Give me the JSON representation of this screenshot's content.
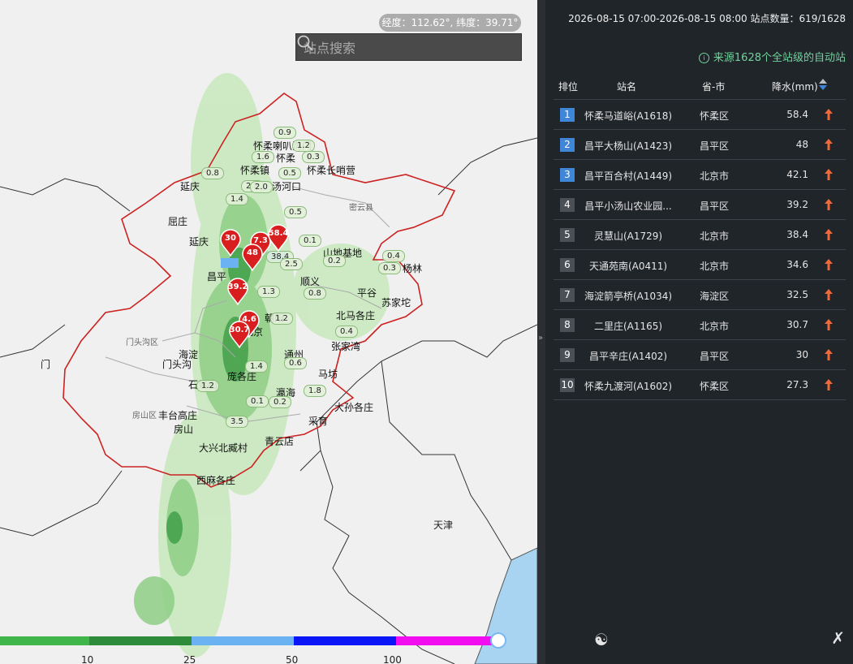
{
  "map": {
    "coord_text": "经度：112.62°, 纬度：39.71°",
    "search_placeholder": "站点搜索",
    "region_labels": {
      "miyun": "密云县",
      "mentougou": "门头沟区",
      "fangshan": "房山区",
      "tianjin": "天津",
      "men": "门"
    },
    "markers": [
      "30",
      "7.3",
      "58.4",
      "48",
      "39.2",
      "4.6",
      "30.7"
    ],
    "station_values": [
      "0.9",
      "1.2",
      "1.6",
      "0.3",
      "0.5",
      "0.8",
      "2.8",
      "1.4",
      "0.5",
      "0.1",
      "0.4",
      "0.3",
      "0.2",
      "38.4",
      "1.3",
      "2.5",
      "0.8",
      "1.4",
      "0.6",
      "2.0",
      "1.2",
      "0.1",
      "0.2",
      "3.5",
      "1.8",
      "0.4",
      "1.2"
    ],
    "station_names": [
      "怀柔喇叭沟门",
      "怀柔",
      "怀柔镇",
      "怀柔长哨营",
      "延庆",
      "汤河口",
      "屈庄",
      "山地基地",
      "延庆",
      "昌平",
      "杨林",
      "苏家坨",
      "海淀",
      "门头沟",
      "丰台高庄",
      "房山",
      "大兴北臧村",
      "西麻各庄",
      "马坊",
      "北马各庄",
      "通州",
      "庞各庄",
      "采育",
      "瀛海",
      "青云店",
      "张家湾",
      "大孙各庄",
      "平谷",
      "北京",
      "石景山",
      "朝阳",
      "顺义"
    ],
    "legend_ticks": [
      "10",
      "25",
      "50",
      "100"
    ]
  },
  "panel": {
    "header": "2026-08-15 07:00-2026-08-15 08:00  站点数量：619/1628",
    "source": "来源1628个全站级的自动站",
    "columns": {
      "rank": "排位",
      "name": "站名",
      "area": "省-市",
      "value": "降水(mm)"
    },
    "rows": [
      {
        "rank": "1",
        "name": "怀柔马道峪(A1618)",
        "area": "怀柔区",
        "value": "58.4"
      },
      {
        "rank": "2",
        "name": "昌平大杨山(A1423)",
        "area": "昌平区",
        "value": "48"
      },
      {
        "rank": "3",
        "name": "昌平百合村(A1449)",
        "area": "北京市",
        "value": "42.1"
      },
      {
        "rank": "4",
        "name": "昌平小汤山农业园...",
        "area": "昌平区",
        "value": "39.2"
      },
      {
        "rank": "5",
        "name": "灵慧山(A1729)",
        "area": "北京市",
        "value": "38.4"
      },
      {
        "rank": "6",
        "name": "天通苑南(A0411)",
        "area": "北京市",
        "value": "34.6"
      },
      {
        "rank": "7",
        "name": "海淀箭亭桥(A1034)",
        "area": "海淀区",
        "value": "32.5"
      },
      {
        "rank": "8",
        "name": "二里庄(A1165)",
        "area": "北京市",
        "value": "30.7"
      },
      {
        "rank": "9",
        "name": "昌平辛庄(A1402)",
        "area": "昌平区",
        "value": "30"
      },
      {
        "rank": "10",
        "name": "怀柔九渡河(A1602)",
        "area": "怀柔区",
        "value": "27.3"
      }
    ]
  },
  "colors": {
    "panel_bg": "#20252a",
    "rank_top": "#3f86d9",
    "source_text": "#6fd49b",
    "up_arrow": "#f0693a",
    "boundary": "#cc2222",
    "marker": "#d81e1e",
    "legend": [
      "#3fb54a",
      "#2e8b3a",
      "#6ab2f2",
      "#0a16f5",
      "#f20cf0",
      "#f20cf0"
    ]
  },
  "icons": {
    "search": "search-icon",
    "up": "arrow-up-icon",
    "sort": "sort-icon",
    "info": "info-icon"
  }
}
